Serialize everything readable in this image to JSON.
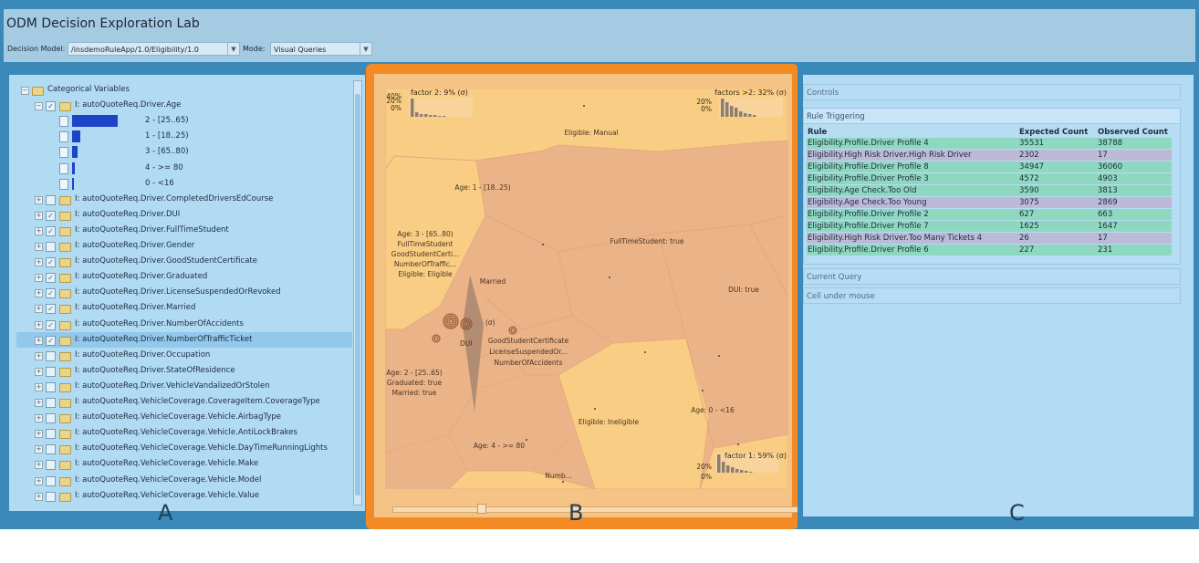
{
  "header": {
    "title": "ODM Decision Exploration Lab",
    "decision_model_label": "Decision Model:",
    "decision_model_value": "/insdemoRuleApp/1.0/Eligibility/1.0",
    "mode_label": "Mode:",
    "mode_value": "Visual Queries"
  },
  "panel_letters": {
    "a": "A",
    "b": "B",
    "c": "C"
  },
  "tree": {
    "root": "Categorical Variables",
    "age_node": "I: autoQuoteReq.Driver.Age",
    "age_bins": [
      {
        "label": "2 - [25..65)",
        "share": 1.0
      },
      {
        "label": "1 - [18..25)",
        "share": 0.17
      },
      {
        "label": "3 - [65..80)",
        "share": 0.12
      },
      {
        "label": "4 - >= 80",
        "share": 0.05
      },
      {
        "label": "0 - <16",
        "share": 0.04
      }
    ],
    "nodes": [
      {
        "label": "I: autoQuoteReq.Driver.CompletedDriversEdCourse",
        "checked": false
      },
      {
        "label": "I: autoQuoteReq.Driver.DUI",
        "checked": true
      },
      {
        "label": "I: autoQuoteReq.Driver.FullTimeStudent",
        "checked": true
      },
      {
        "label": "I: autoQuoteReq.Driver.Gender",
        "checked": false
      },
      {
        "label": "I: autoQuoteReq.Driver.GoodStudentCertificate",
        "checked": true
      },
      {
        "label": "I: autoQuoteReq.Driver.Graduated",
        "checked": true
      },
      {
        "label": "I: autoQuoteReq.Driver.LicenseSuspendedOrRevoked",
        "checked": true
      },
      {
        "label": "I: autoQuoteReq.Driver.Married",
        "checked": true
      },
      {
        "label": "I: autoQuoteReq.Driver.NumberOfAccidents",
        "checked": true
      },
      {
        "label": "I: autoQuoteReq.Driver.NumberOfTrafficTicket",
        "checked": true,
        "selected": true
      },
      {
        "label": "I: autoQuoteReq.Driver.Occupation",
        "checked": false
      },
      {
        "label": "I: autoQuoteReq.Driver.StateOfResidence",
        "checked": false
      },
      {
        "label": "I: autoQuoteReq.Driver.VehicleVandalizedOrStolen",
        "checked": false
      },
      {
        "label": "I: autoQuoteReq.VehicleCoverage.CoverageItem.CoverageType",
        "checked": false
      },
      {
        "label": "I: autoQuoteReq.VehicleCoverage.Vehicle.AirbagType",
        "checked": false
      },
      {
        "label": "I: autoQuoteReq.VehicleCoverage.Vehicle.AntiLockBrakes",
        "checked": false
      },
      {
        "label": "I: autoQuoteReq.VehicleCoverage.Vehicle.DayTimeRunningLights",
        "checked": false
      },
      {
        "label": "I: autoQuoteReq.VehicleCoverage.Vehicle.Make",
        "checked": false
      },
      {
        "label": "I: autoQuoteReq.VehicleCoverage.Vehicle.Model",
        "checked": false
      },
      {
        "label": "I: autoQuoteReq.VehicleCoverage.Vehicle.Value",
        "checked": false
      }
    ]
  },
  "map": {
    "factor2": {
      "title": "factor 2: 9% (σ)",
      "ticks": [
        "40%",
        "20%",
        "0%"
      ]
    },
    "factor_gt2": {
      "title": "factors >2: 32% (σ)",
      "ticks": [
        "20%",
        "0%"
      ]
    },
    "factor1": {
      "title": "factor 1: 59% (σ)",
      "ticks": [
        "20%",
        "0%"
      ]
    },
    "labels": [
      "Eligible: Manual",
      "Age: 1 - [18..25)",
      "FullTimeStudent: true",
      "DUI: true",
      "Married",
      "DUI",
      "GoodStudentCertificate",
      "LicenseSuspendedOr...",
      "NumberOfAccidents",
      "Age: 0 - <16",
      "Eligible: Ineligible",
      "Age: 4 - >= 80",
      "Numb...",
      "Age: 3 - [65..80)",
      "FullTimeStudent",
      "GoodStudentCerti...",
      "NumberOfTraffic...",
      "Eligible: Eligible",
      "Age: 2 - [25..65)",
      "Graduated: true",
      "Married: true",
      "(σ)"
    ]
  },
  "controls": {
    "controls_label": "Controls",
    "rule_triggering_label": "Rule Triggering",
    "current_query_label": "Current Query",
    "cell_under_mouse_label": "Cell under mouse",
    "table": {
      "headers": [
        "Rule",
        "Expected Count",
        "Observed Count"
      ],
      "rows": [
        {
          "rule": "Eligibility.Profile.Driver Profile 4",
          "expected": "35531",
          "observed": "38788",
          "status": "ok"
        },
        {
          "rule": "Eligibility.High Risk Driver.High Risk Driver",
          "expected": "2302",
          "observed": "17",
          "status": "bad"
        },
        {
          "rule": "Eligibility.Profile.Driver Profile 8",
          "expected": "34947",
          "observed": "36060",
          "status": "ok"
        },
        {
          "rule": "Eligibility.Profile.Driver Profile 3",
          "expected": "4572",
          "observed": "4903",
          "status": "ok"
        },
        {
          "rule": "Eligibility.Age Check.Too Old",
          "expected": "3590",
          "observed": "3813",
          "status": "ok"
        },
        {
          "rule": "Eligibility.Age Check.Too Young",
          "expected": "3075",
          "observed": "2869",
          "status": "bad"
        },
        {
          "rule": "Eligibility.Profile.Driver Profile 2",
          "expected": "627",
          "observed": "663",
          "status": "ok"
        },
        {
          "rule": "Eligibility.Profile.Driver Profile 7",
          "expected": "1625",
          "observed": "1647",
          "status": "ok"
        },
        {
          "rule": "Eligibility.High Risk Driver.Too Many Tickets 4",
          "expected": "26",
          "observed": "17",
          "status": "bad"
        },
        {
          "rule": "Eligibility.Profile.Driver Profile 6",
          "expected": "227",
          "observed": "231",
          "status": "ok"
        }
      ]
    }
  },
  "colors": {
    "frame": "#3a89b9",
    "panel_b_border": "#f48a24",
    "cell_light": "#f9cd84",
    "cell_dark": "#ebb388",
    "row_ok": "#8ed8c0",
    "row_bad": "#bcbad7"
  }
}
